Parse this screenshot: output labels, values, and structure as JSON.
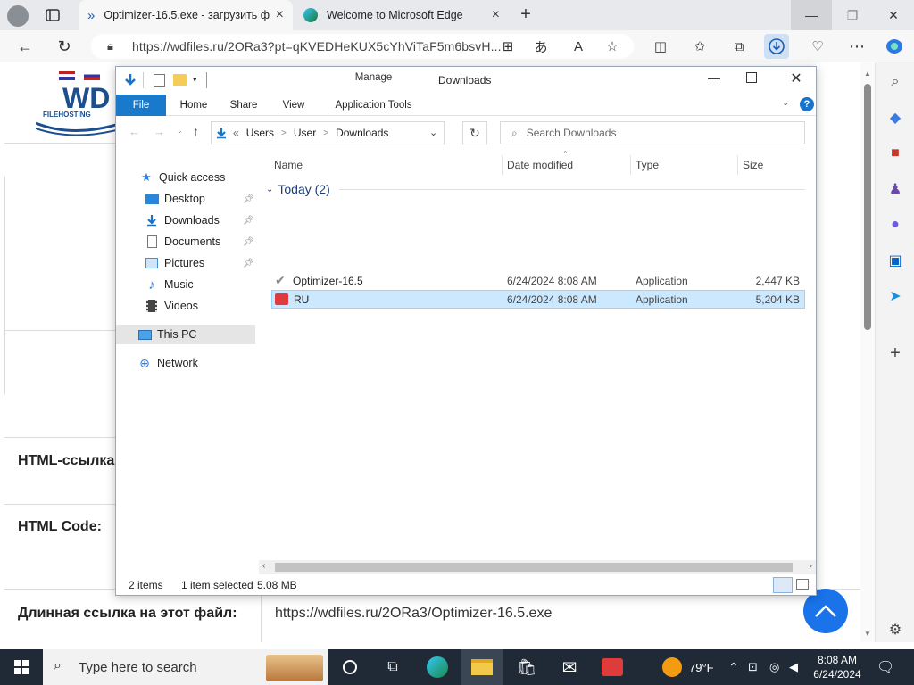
{
  "browser": {
    "tabs": [
      {
        "title": "Optimizer-16.5.exe - загрузить ф",
        "active": true
      },
      {
        "title": "Welcome to Microsoft Edge",
        "active": false
      }
    ],
    "url": "https://wdfiles.ru/2ORa3?pt=qKVEDHeKUX5cYhViTaF5m6bsvH..."
  },
  "page": {
    "logo_text": "WD",
    "logo_sub": "FILEHOSTING",
    "rows": [
      {
        "label": "HTML-ссылка"
      },
      {
        "label": "HTML Code:"
      },
      {
        "label": "Длинная ссылка на этот файл:",
        "value": "https://wdfiles.ru/2ORa3/Optimizer-16.5.exe"
      }
    ]
  },
  "explorer": {
    "title": "Downloads",
    "manage_label": "Manage",
    "ribbon_tabs": [
      "File",
      "Home",
      "Share",
      "View",
      "Application Tools"
    ],
    "breadcrumb": [
      "«",
      "Users",
      ">",
      "User",
      ">",
      "Downloads"
    ],
    "search_placeholder": "Search Downloads",
    "nav": {
      "quick_access": "Quick access",
      "items": [
        "Desktop",
        "Downloads",
        "Documents",
        "Pictures",
        "Music",
        "Videos"
      ],
      "this_pc": "This PC",
      "network": "Network"
    },
    "columns": [
      "Name",
      "Date modified",
      "Type",
      "Size"
    ],
    "group": "Today (2)",
    "files": [
      {
        "name": "Optimizer-16.5",
        "date": "6/24/2024 8:08 AM",
        "type": "Application",
        "size": "2,447 KB",
        "selected": false
      },
      {
        "name": "RU",
        "date": "6/24/2024 8:08 AM",
        "type": "Application",
        "size": "5,204 KB",
        "selected": true
      }
    ],
    "status": {
      "items": "2 items",
      "selected": "1 item selected",
      "size": "5.08 MB"
    }
  },
  "taskbar": {
    "search_placeholder": "Type here to search",
    "weather": "79°F",
    "time": "8:08 AM",
    "date": "6/24/2024"
  },
  "colors": {
    "accent": "#1979ca",
    "selection": "#cce8ff",
    "manage_band": "#f0d8fb"
  }
}
